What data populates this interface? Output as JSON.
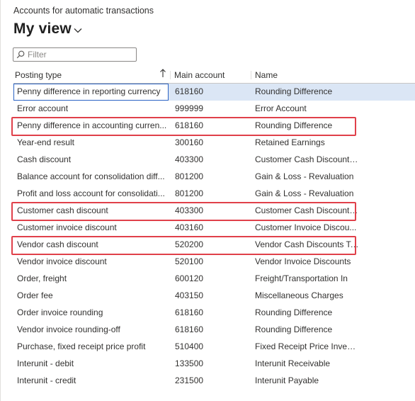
{
  "page": {
    "caption": "Accounts for automatic transactions",
    "view_title": "My view"
  },
  "filter": {
    "placeholder": "Filter"
  },
  "columns": {
    "posting_type": "Posting type",
    "main_account": "Main account",
    "name": "Name"
  },
  "rows": [
    {
      "posting_type": "Penny difference in reporting currency",
      "main_account": "618160",
      "name": "Rounding Difference",
      "selected": true,
      "highlighted": false
    },
    {
      "posting_type": "Error account",
      "main_account": "999999",
      "name": "Error Account",
      "selected": false,
      "highlighted": false
    },
    {
      "posting_type": "Penny difference in accounting curren...",
      "main_account": "618160",
      "name": "Rounding Difference",
      "selected": false,
      "highlighted": true
    },
    {
      "posting_type": "Year-end result",
      "main_account": "300160",
      "name": "Retained Earnings",
      "selected": false,
      "highlighted": false
    },
    {
      "posting_type": "Cash discount",
      "main_account": "403300",
      "name": "Customer Cash Discounts...",
      "selected": false,
      "highlighted": false
    },
    {
      "posting_type": "Balance account for consolidation diff...",
      "main_account": "801200",
      "name": "Gain & Loss - Revaluation",
      "selected": false,
      "highlighted": false
    },
    {
      "posting_type": "Profit and loss account for consolidati...",
      "main_account": "801200",
      "name": "Gain & Loss - Revaluation",
      "selected": false,
      "highlighted": false
    },
    {
      "posting_type": "Customer cash discount",
      "main_account": "403300",
      "name": "Customer Cash Discounts...",
      "selected": false,
      "highlighted": true
    },
    {
      "posting_type": "Customer invoice discount",
      "main_account": "403160",
      "name": "Customer Invoice Discou...",
      "selected": false,
      "highlighted": false
    },
    {
      "posting_type": "Vendor cash discount",
      "main_account": "520200",
      "name": "Vendor Cash Discounts Ta...",
      "selected": false,
      "highlighted": true
    },
    {
      "posting_type": "Vendor invoice discount",
      "main_account": "520100",
      "name": "Vendor Invoice Discounts",
      "selected": false,
      "highlighted": false
    },
    {
      "posting_type": "Order, freight",
      "main_account": "600120",
      "name": "Freight/Transportation In",
      "selected": false,
      "highlighted": false
    },
    {
      "posting_type": "Order fee",
      "main_account": "403150",
      "name": "Miscellaneous Charges",
      "selected": false,
      "highlighted": false
    },
    {
      "posting_type": "Order invoice rounding",
      "main_account": "618160",
      "name": "Rounding Difference",
      "selected": false,
      "highlighted": false
    },
    {
      "posting_type": "Vendor invoice rounding-off",
      "main_account": "618160",
      "name": "Rounding Difference",
      "selected": false,
      "highlighted": false
    },
    {
      "posting_type": "Purchase, fixed receipt price profit",
      "main_account": "510400",
      "name": "Fixed Receipt Price Invent...",
      "selected": false,
      "highlighted": false
    },
    {
      "posting_type": "Interunit - debit",
      "main_account": "133500",
      "name": "Interunit Receivable",
      "selected": false,
      "highlighted": false
    },
    {
      "posting_type": "Interunit - credit",
      "main_account": "231500",
      "name": "Interunit Payable",
      "selected": false,
      "highlighted": false
    }
  ],
  "icons": {
    "view_dropdown": "chevron-down-icon",
    "filter": "search-icon",
    "sort": "sort-ascending-arrow-icon"
  },
  "colors": {
    "selection_background": "#dbe6f5",
    "selection_border": "#2b63c4",
    "highlight_box": "#e0404a"
  }
}
